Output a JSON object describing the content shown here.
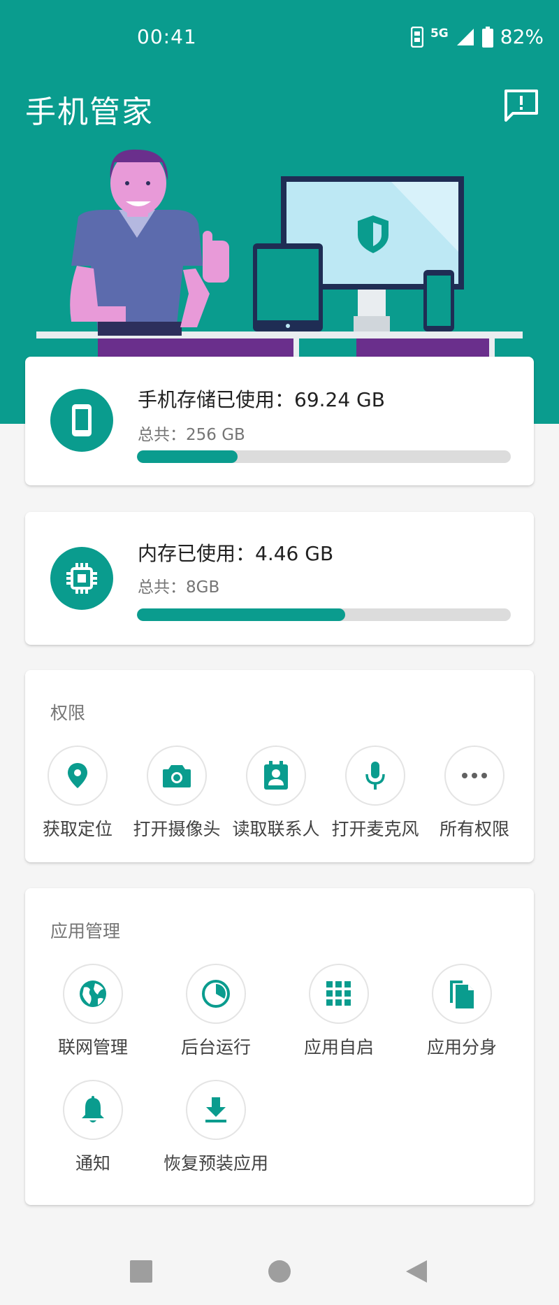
{
  "status_bar": {
    "time": "00:41",
    "network": "5G",
    "battery": "82%"
  },
  "app_bar": {
    "title": "手机管家",
    "feedback_icon": "feedback-icon"
  },
  "storage": {
    "title": "手机存储已使用：69.24 GB",
    "total": "总共：256 GB",
    "used_fraction": 0.27,
    "icon": "phone-icon"
  },
  "memory": {
    "title": "内存已使用：4.46 GB",
    "total": "总共：8GB",
    "used_fraction": 0.557,
    "icon": "chip-icon"
  },
  "permissions": {
    "title": "权限",
    "items": [
      {
        "label": "获取定位",
        "icon": "location-icon"
      },
      {
        "label": "打开摄像头",
        "icon": "camera-icon"
      },
      {
        "label": "读取联系人",
        "icon": "contacts-icon"
      },
      {
        "label": "打开麦克风",
        "icon": "microphone-icon"
      },
      {
        "label": "所有权限",
        "icon": "more-icon"
      }
    ]
  },
  "app_management": {
    "title": "应用管理",
    "items": [
      {
        "label": "联网管理",
        "icon": "globe-icon"
      },
      {
        "label": "后台运行",
        "icon": "background-run-icon"
      },
      {
        "label": "应用自启",
        "icon": "grid-icon"
      },
      {
        "label": "应用分身",
        "icon": "clone-icon"
      },
      {
        "label": "通知",
        "icon": "bell-icon"
      },
      {
        "label": "恢复预装应用",
        "icon": "download-icon"
      }
    ]
  },
  "navigation": {
    "recents": "square-icon",
    "home": "circle-icon",
    "back": "triangle-back-icon"
  },
  "colors": {
    "accent": "#0a9c8e",
    "background": "#f5f5f5",
    "card": "#ffffff"
  }
}
